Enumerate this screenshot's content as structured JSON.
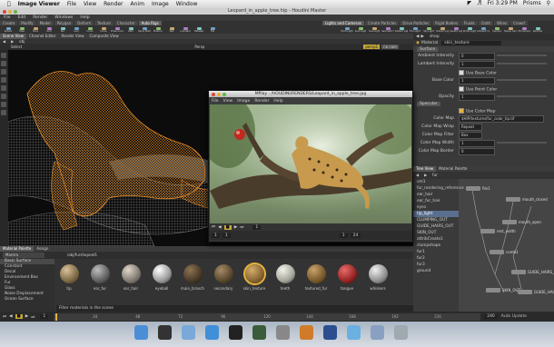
{
  "mac_menubar": {
    "apple": "",
    "app_name": "Image Viewer",
    "items": [
      "File",
      "View",
      "Render",
      "Anim",
      "Image",
      "Window"
    ],
    "clock": "Fri 3:29 PM",
    "user": "Prisms"
  },
  "window_title": "Leopard_in_apple_tree.hip - Houdini Master",
  "houdini_menu": [
    "File",
    "Edit",
    "Render",
    "Windows",
    "Help"
  ],
  "shelf_tabs_left": [
    "Create",
    "Modify",
    "Model",
    "Polygon",
    "Deform",
    "Texture",
    "Character",
    "Auto Rigs"
  ],
  "shelf_tabs_right": [
    "Lights and Cameras",
    "Create Particles",
    "Drive Particles",
    "Rigid Bodies",
    "Fluids",
    "Cloth",
    "Wires",
    "Crowd"
  ],
  "shelf_tools": [
    "Sphere",
    "Tube",
    "Torus",
    "Grid",
    "Null",
    "Line",
    "Circle",
    "Curve",
    "Draw Curve",
    "Path",
    "Spray Paint",
    "Platonic",
    "Text",
    "L-System",
    "Metaball",
    "File"
  ],
  "shelf_tools_right": [
    "Point Light",
    "Spot Light",
    "Area Light",
    "Geometry Light",
    "Distant Light",
    "Env Light",
    "Sky Light",
    "Indirect Light",
    "Caustic Light",
    "Portal Light",
    "Ambient Light",
    "Camera",
    "Stereo Camera",
    "VR Camera",
    "Switcher"
  ],
  "left_tabs": [
    "Scene View",
    "Channel Editor",
    "Render View",
    "Composite View"
  ],
  "viewport": {
    "path": "obj",
    "toolbar_label": "Select",
    "center_label": "Persp",
    "badges": [
      "persp1",
      "no cam"
    ]
  },
  "right_panel": {
    "header": "shop",
    "node_type": "Material",
    "node_name": "skin_texture",
    "tab": "Surface",
    "params": [
      {
        "label": "Ambient Intensity",
        "value": "0"
      },
      {
        "label": "Lambert Intensity",
        "value": "1"
      },
      {
        "label": "Base Color",
        "value": "1"
      },
      {
        "label": "Opacity",
        "value": "1"
      }
    ],
    "use_base_color": "Use Base Color",
    "use_point_color": "Use Point Color",
    "section_specular": "Specular",
    "use_color_map": "Use Color Map",
    "color_map_label": "Color Map",
    "color_map_value": "$HIP/textures/fur_color_tip.tif",
    "map_rows": [
      "Color Map Wrap",
      "Color Map Filter",
      "Color Map Width",
      "Color Map Border"
    ],
    "map_values": [
      "Repeat",
      "Box",
      "1",
      "0"
    ]
  },
  "network_panel": {
    "tabs": [
      "Tree View",
      "Material Palette"
    ],
    "path": "fur",
    "tree_items": [
      "vm1",
      "fur_rendering_reference",
      "ear_hair",
      "ear_fur_hair",
      "eyes",
      "tip_light",
      "CLUMPING_OUT",
      "GUIDE_HAIRS_OUT",
      "SKIN_OUT",
      "attribCreate1",
      "clumpshape",
      "fur1",
      "fur2",
      "fur3",
      "ground"
    ],
    "tree_selected": "tip_light",
    "nodes": [
      "file1",
      "mouth_closed",
      "mouth_open",
      "rest_width",
      "comb1",
      "GUIDE_HAIRS_OUT",
      "SKIN_OUT",
      "GUIDE_HAIRS_IN"
    ]
  },
  "material_palette": {
    "tabs": [
      "Material Palette",
      "Assign"
    ],
    "library": "Mantra",
    "library_items": [
      "Basic Surface",
      "Constant",
      "Decal",
      "Environment Box",
      "Fur",
      "Glass",
      "Noise Displacement",
      "Ocean Surface"
    ],
    "shop_path": "/obj/furshopnet1",
    "materials": [
      "tip",
      "ear_fur",
      "ear_hair",
      "eyeball",
      "main_branch",
      "secondary",
      "skin_texture",
      "teeth",
      "textured_fur",
      "tongue",
      "whiskers"
    ],
    "materials_row2": [
      "",
      "",
      "",
      "",
      "",
      "",
      "",
      "",
      "",
      "",
      ""
    ],
    "footer": "Filter materials in the scene"
  },
  "mplay": {
    "title": "MPlay : /HOUDINI/RENDERS/Leopard_in_apple_tree.jpg",
    "menus": [
      "File",
      "View",
      "Image",
      "Render",
      "Help"
    ],
    "frame_fields": [
      "1",
      "1",
      "1",
      "24"
    ],
    "frame_value": "1"
  },
  "playbar": {
    "start": "1",
    "end": "240",
    "current": "1",
    "ticks": [
      "24",
      "48",
      "72",
      "96",
      "120",
      "144",
      "168",
      "192",
      "216"
    ],
    "status": "Auto Update"
  },
  "dock": {
    "apps": [
      "Finder",
      "Dashboard",
      "Mail",
      "Safari",
      "Terminal",
      "Activity Monitor",
      "System Preferences",
      "Houdini",
      "Photoshop",
      "Preview",
      "Documents",
      "Trash"
    ]
  }
}
